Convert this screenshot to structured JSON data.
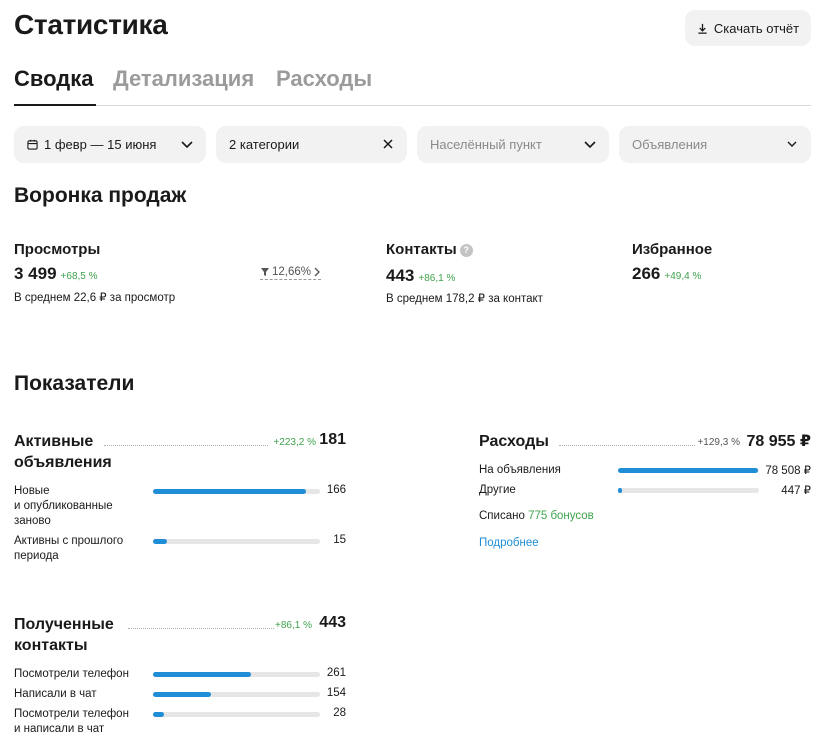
{
  "header": {
    "title": "Статистика",
    "download_label": "Скачать отчёт"
  },
  "tabs": [
    {
      "label": "Сводка",
      "active": true
    },
    {
      "label": "Детализация",
      "active": false
    },
    {
      "label": "Расходы",
      "active": false
    }
  ],
  "filters": {
    "date": "1 февр — 15 июня",
    "categories": "2 категории",
    "city_placeholder": "Населённый пункт",
    "ads_placeholder": "Объявления"
  },
  "funnel": {
    "title": "Воронка продаж",
    "views": {
      "label": "Просмотры",
      "value": "3 499",
      "delta": "+68,5 %",
      "sub": "В среднем 22,6 ₽ за просмотр"
    },
    "conversion": "12,66%",
    "contacts": {
      "label": "Контакты",
      "value": "443",
      "delta": "+86,1 %",
      "sub": "В среднем 178,2 ₽ за контакт",
      "help": "?"
    },
    "favorites": {
      "label": "Избранное",
      "value": "266",
      "delta": "+49,4 %"
    }
  },
  "metrics": {
    "title": "Показатели",
    "active_ads": {
      "label_line1": "Активные",
      "label_line2": "объявления",
      "delta": "+223,2 %",
      "value": "181",
      "rows": [
        {
          "label_lines": [
            "Новые",
            "и опубликованные",
            "заново"
          ],
          "value": "166",
          "fraction": 0.917
        },
        {
          "label_lines": [
            "Активны с прошлого",
            "периода"
          ],
          "value": "15",
          "fraction": 0.083
        }
      ]
    },
    "expenses": {
      "label": "Расходы",
      "delta": "+129,3 %",
      "value": "78 955 ₽",
      "rows": [
        {
          "label": "На объявления",
          "value": "78 508 ₽",
          "fraction": 0.994
        },
        {
          "label": "Другие",
          "value": "447 ₽",
          "fraction": 0.03
        }
      ],
      "written_off_prefix": "Списано",
      "written_off_bonus": "775 бонусов",
      "more_link": "Подробнее"
    },
    "contacts": {
      "label_line1": "Полученные",
      "label_line2": "контакты",
      "delta": "+86,1 %",
      "value": "443",
      "rows": [
        {
          "label_lines": [
            "Посмотрели телефон"
          ],
          "value": "261",
          "fraction": 0.589
        },
        {
          "label_lines": [
            "Написали в чат"
          ],
          "value": "154",
          "fraction": 0.348
        },
        {
          "label_lines": [
            "Посмотрели телефон",
            "и написали в чат"
          ],
          "value": "28",
          "fraction": 0.063
        }
      ]
    }
  },
  "colors": {
    "accent_blue": "#1f8ed6",
    "positive_green": "#3fa34d",
    "filter_bg": "#f2f2f2"
  }
}
